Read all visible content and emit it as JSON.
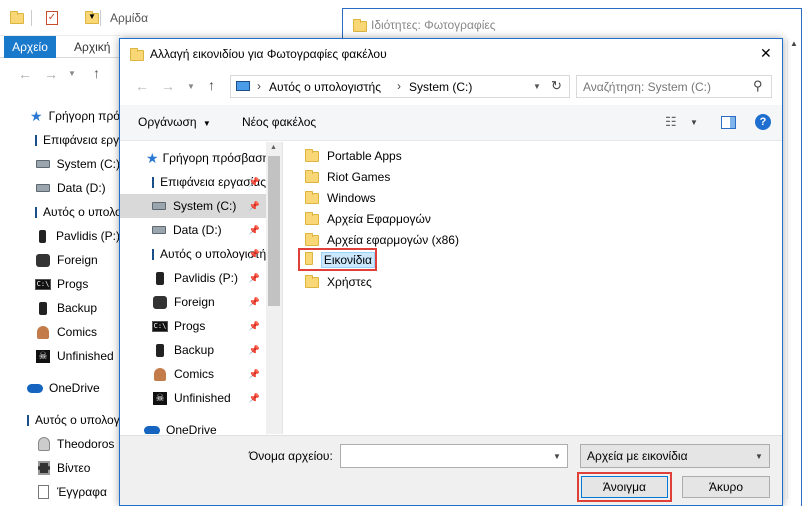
{
  "bg_window": {
    "title": "Αρμίδα",
    "ribbon_tabs": [
      "Αρχείο",
      "Αρχική"
    ],
    "nav": [
      {
        "label": "Γρήγορη πρόσβαση",
        "icon": "star-icon"
      },
      {
        "label": "Επιφάνεια εργασίας",
        "icon": "monitor-icon"
      },
      {
        "label": "System (C:)",
        "icon": "drive-icon"
      },
      {
        "label": "Data (D:)",
        "icon": "drive-icon"
      },
      {
        "label": "Αυτός ο υπολογιστής",
        "icon": "monitor-icon"
      },
      {
        "label": "Pavlidis (P:)",
        "icon": "phone-icon"
      },
      {
        "label": "Foreign",
        "icon": "game-icon"
      },
      {
        "label": "Progs",
        "icon": "console-icon"
      },
      {
        "label": "Backup",
        "icon": "phone-icon"
      },
      {
        "label": "Comics",
        "icon": "comics-icon"
      },
      {
        "label": "Unfinished",
        "icon": "skull-icon"
      },
      {
        "label": "OneDrive",
        "icon": "cloud-icon"
      },
      {
        "label": "Αυτός ο υπολογιστής",
        "icon": "pc-icon"
      },
      {
        "label": "Theodoros",
        "icon": "user-icon"
      },
      {
        "label": "Βίντεο",
        "icon": "video-icon"
      },
      {
        "label": "Έγγραφα",
        "icon": "document-icon"
      }
    ]
  },
  "props_window": {
    "title": "Ιδιότητες: Φωτογραφίες"
  },
  "dialog": {
    "title": "Αλλαγή εικονιδίου για Φωτογραφίες φακέλου",
    "close_glyph": "✕",
    "breadcrumb": [
      "Αυτός ο υπολογιστής",
      "System (C:)"
    ],
    "search_placeholder": "Αναζήτηση: System (C:)",
    "toolbar": {
      "organize": "Οργάνωση",
      "new_folder": "Νέος φακέλος"
    },
    "nav": [
      {
        "label": "Γρήγορη πρόσβαση",
        "icon": "star-icon",
        "pinned": false
      },
      {
        "label": "Επιφάνεια εργασίας",
        "icon": "monitor-icon",
        "pinned": true
      },
      {
        "label": "System (C:)",
        "icon": "drive-icon",
        "pinned": true,
        "selected": true
      },
      {
        "label": "Data (D:)",
        "icon": "drive-icon",
        "pinned": true
      },
      {
        "label": "Αυτός ο υπολογιστής",
        "icon": "monitor-icon",
        "pinned": true
      },
      {
        "label": "Pavlidis (P:)",
        "icon": "phone-icon",
        "pinned": true
      },
      {
        "label": "Foreign",
        "icon": "game-icon",
        "pinned": true
      },
      {
        "label": "Progs",
        "icon": "console-icon",
        "pinned": true
      },
      {
        "label": "Backup",
        "icon": "phone-icon",
        "pinned": true
      },
      {
        "label": "Comics",
        "icon": "comics-icon",
        "pinned": true
      },
      {
        "label": "Unfinished",
        "icon": "skull-icon",
        "pinned": true
      },
      {
        "label": "OneDrive",
        "icon": "cloud-icon",
        "pinned": false
      }
    ],
    "files": [
      {
        "name": "Portable Apps"
      },
      {
        "name": "Riot Games"
      },
      {
        "name": "Windows"
      },
      {
        "name": "Αρχεία Εφαρμογών"
      },
      {
        "name": "Αρχεία εφαρμογών (x86)"
      },
      {
        "name": "Εικονίδια",
        "selected": true
      },
      {
        "name": "Χρήστες"
      }
    ],
    "filename_label": "Όνομα αρχείου:",
    "filename_value": "",
    "filetype": "Αρχεία με εικονίδια",
    "open_button": "Άνοιγμα",
    "cancel_button": "Άκυρο"
  },
  "colors": {
    "accent": "#2b6cc4",
    "highlight_box": "#e0403a",
    "selected_bg": "#cce8ff"
  }
}
